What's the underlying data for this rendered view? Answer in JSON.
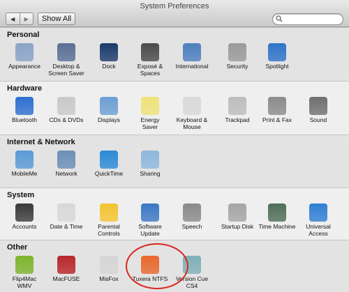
{
  "window": {
    "title": "System Preferences"
  },
  "toolbar": {
    "back": "◀",
    "forward": "▶",
    "show_all": "Show All",
    "search_placeholder": ""
  },
  "sections": {
    "personal": {
      "title": "Personal",
      "items": [
        {
          "label": "Appearance",
          "icon": "appearance-icon",
          "color": "#8aa3c8"
        },
        {
          "label": "Desktop &\nScreen Saver",
          "icon": "desktop-icon",
          "color": "#5a6f96"
        },
        {
          "label": "Dock",
          "icon": "dock-icon",
          "color": "#1b3a6b"
        },
        {
          "label": "Exposé &\nSpaces",
          "icon": "expose-icon",
          "color": "#4a4a4a"
        },
        {
          "label": "International",
          "icon": "flag-icon",
          "color": "#4d7fbf"
        },
        {
          "label": "Security",
          "icon": "house-lock-icon",
          "color": "#9a9a9a"
        },
        {
          "label": "Spotlight",
          "icon": "spotlight-icon",
          "color": "#2f73c9"
        }
      ]
    },
    "hardware": {
      "title": "Hardware",
      "items": [
        {
          "label": "Bluetooth",
          "icon": "bluetooth-icon",
          "color": "#2f6fd0"
        },
        {
          "label": "CDs & DVDs",
          "icon": "disc-icon",
          "color": "#c9c9c9"
        },
        {
          "label": "Displays",
          "icon": "display-icon",
          "color": "#6c9ed4"
        },
        {
          "label": "Energy\nSaver",
          "icon": "bulb-icon",
          "color": "#f0e27a"
        },
        {
          "label": "Keyboard &\nMouse",
          "icon": "keyboard-mouse-icon",
          "color": "#d9d9d9"
        },
        {
          "label": "Trackpad",
          "icon": "trackpad-icon",
          "color": "#bdbdbd"
        },
        {
          "label": "Print & Fax",
          "icon": "printer-icon",
          "color": "#8b8b8b"
        },
        {
          "label": "Sound",
          "icon": "speaker-icon",
          "color": "#707070"
        }
      ]
    },
    "internet": {
      "title": "Internet & Network",
      "items": [
        {
          "label": "MobileMe",
          "icon": "cloud-icon",
          "color": "#5a9ad8"
        },
        {
          "label": "Network",
          "icon": "globe-icon",
          "color": "#6a8fb8"
        },
        {
          "label": "QuickTime",
          "icon": "quicktime-icon",
          "color": "#2d8ad6"
        },
        {
          "label": "Sharing",
          "icon": "folder-icon",
          "color": "#8fb7de"
        }
      ]
    },
    "system": {
      "title": "System",
      "items": [
        {
          "label": "Accounts",
          "icon": "users-icon",
          "color": "#3a3a3a"
        },
        {
          "label": "Date & Time",
          "icon": "clock-icon",
          "color": "#d8d8d8"
        },
        {
          "label": "Parental\nControls",
          "icon": "parental-icon",
          "color": "#f2c431"
        },
        {
          "label": "Software\nUpdate",
          "icon": "update-icon",
          "color": "#3b78c4"
        },
        {
          "label": "Speech",
          "icon": "microphone-icon",
          "color": "#8a8a8a"
        },
        {
          "label": "Startup Disk",
          "icon": "hard-disk-icon",
          "color": "#a5a5a5"
        },
        {
          "label": "Time Machine",
          "icon": "time-machine-icon",
          "color": "#4f6e58"
        },
        {
          "label": "Universal\nAccess",
          "icon": "accessibility-icon",
          "color": "#2f7fd4"
        }
      ]
    },
    "other": {
      "title": "Other",
      "items": [
        {
          "label": "Flip4Mac\nWMV",
          "icon": "wmv-icon",
          "color": "#7db52d"
        },
        {
          "label": "MacFUSE",
          "icon": "macfuse-icon",
          "color": "#b8262a"
        },
        {
          "label": "MisFox",
          "icon": "misfox-icon",
          "color": "#d6d6d6"
        },
        {
          "label": "Tuxera NTFS",
          "icon": "tuxera-icon",
          "color": "#e8682c"
        },
        {
          "label": "Version Cue\nCS4",
          "icon": "version-cue-icon",
          "color": "#7fb0b8"
        }
      ]
    }
  }
}
